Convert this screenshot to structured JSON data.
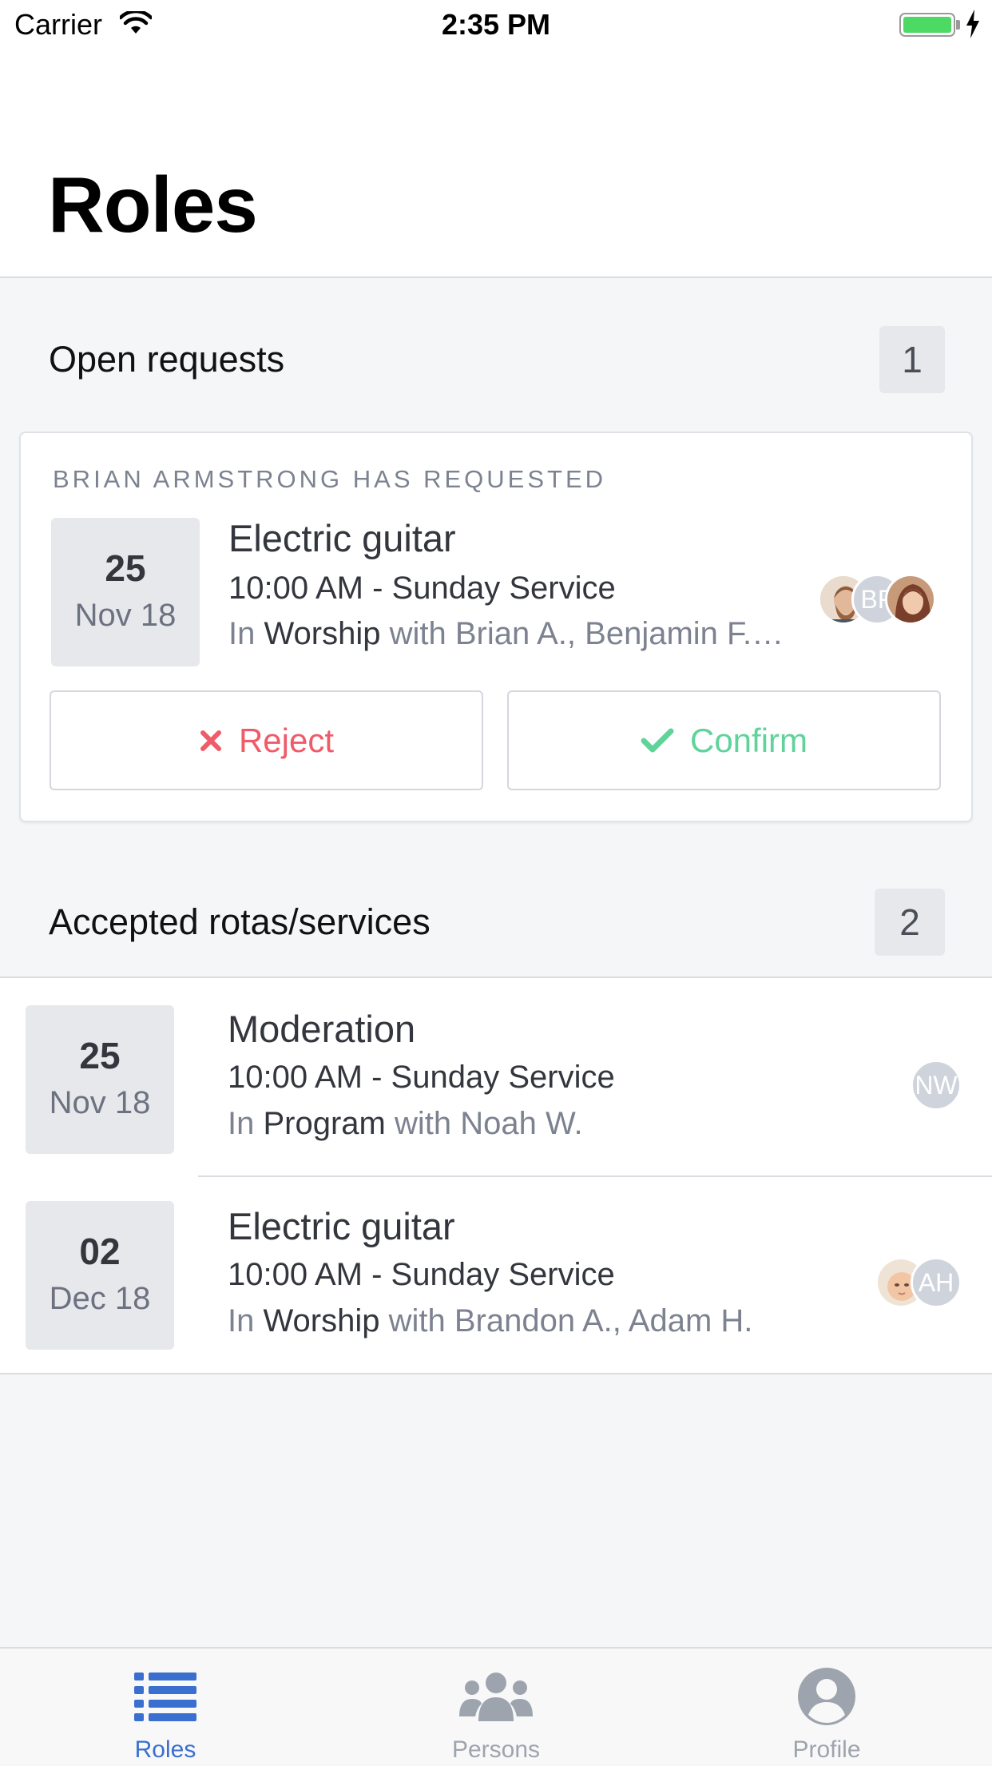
{
  "status_bar": {
    "carrier": "Carrier",
    "time": "2:35 PM"
  },
  "header": {
    "title": "Roles"
  },
  "open_requests": {
    "title": "Open requests",
    "count": "1",
    "card": {
      "caption": "BRIAN ARMSTRONG HAS REQUESTED",
      "date_day": "25",
      "date_month": "Nov 18",
      "role": "Electric guitar",
      "time": "10:00 AM - Sunday Service",
      "context_prefix": "In",
      "team": "Worship",
      "context_suffix": "with Brian A., Benjamin F.…",
      "avatars": [
        {
          "type": "photo",
          "icon": "person-photo-man"
        },
        {
          "type": "initials",
          "text": "BF"
        },
        {
          "type": "photo",
          "icon": "person-photo-woman"
        }
      ],
      "reject_label": "Reject",
      "confirm_label": "Confirm"
    }
  },
  "accepted": {
    "title": "Accepted rotas/services",
    "count": "2",
    "items": [
      {
        "date_day": "25",
        "date_month": "Nov 18",
        "role": "Moderation",
        "time": "10:00 AM - Sunday Service",
        "context_prefix": "In",
        "team": "Program",
        "context_suffix": "with Noah W.",
        "avatars": [
          {
            "type": "initials",
            "text": "NW"
          }
        ]
      },
      {
        "date_day": "02",
        "date_month": "Dec 18",
        "role": "Electric guitar",
        "time": "10:00 AM - Sunday Service",
        "context_prefix": "In",
        "team": "Worship",
        "context_suffix": "with Brandon A., Adam H.",
        "avatars": [
          {
            "type": "photo",
            "icon": "person-photo-baby"
          },
          {
            "type": "initials",
            "text": "AH"
          }
        ]
      }
    ]
  },
  "tab_bar": {
    "tabs": [
      {
        "label": "Roles",
        "icon": "list-icon",
        "active": true
      },
      {
        "label": "Persons",
        "icon": "people-icon",
        "active": false
      },
      {
        "label": "Profile",
        "icon": "profile-icon",
        "active": false
      }
    ]
  },
  "colors": {
    "accent": "#3a6fcf",
    "reject": "#ef5b69",
    "confirm": "#5fd39a",
    "background": "#f5f6f8"
  }
}
